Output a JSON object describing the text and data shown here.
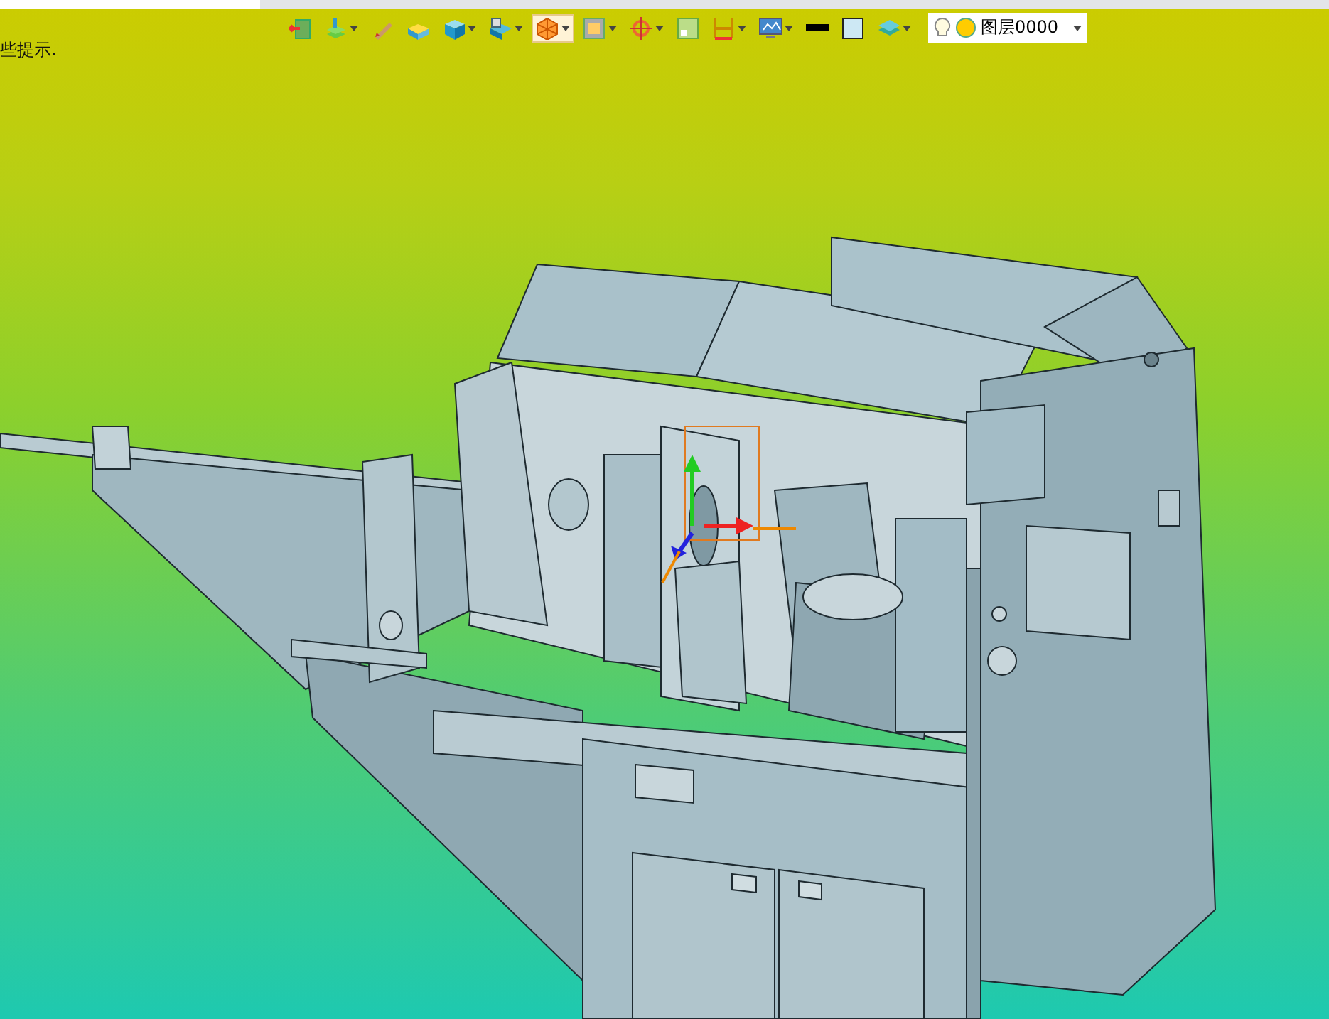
{
  "toolbar": {
    "buttons": [
      {
        "kind": "exit",
        "menu": false,
        "selected": false
      },
      {
        "kind": "layers",
        "menu": true,
        "selected": false
      },
      {
        "kind": "pencil",
        "menu": false,
        "selected": false
      },
      {
        "kind": "box",
        "menu": false,
        "selected": false
      },
      {
        "kind": "cube",
        "menu": true,
        "selected": false
      },
      {
        "kind": "view",
        "menu": true,
        "selected": false
      },
      {
        "kind": "polygon",
        "menu": true,
        "selected": true
      },
      {
        "kind": "frame",
        "menu": true,
        "selected": false
      },
      {
        "kind": "target",
        "menu": true,
        "selected": false
      },
      {
        "kind": "image",
        "menu": false,
        "selected": false
      },
      {
        "kind": "dimension",
        "menu": true,
        "selected": false
      },
      {
        "kind": "monitor",
        "menu": true,
        "selected": false
      },
      {
        "kind": "line",
        "menu": false,
        "selected": false
      },
      {
        "kind": "fill",
        "menu": false,
        "selected": false
      },
      {
        "kind": "stack",
        "menu": true,
        "selected": false
      }
    ],
    "layer_select": {
      "value": "图层0000"
    }
  },
  "hint": "些提示."
}
